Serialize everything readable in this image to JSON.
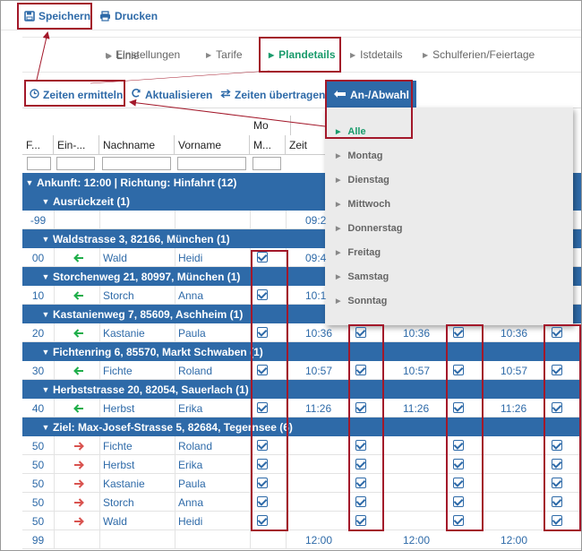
{
  "toolbar": {
    "save": "Speichern",
    "print": "Drucken"
  },
  "tabs": [
    {
      "label": "Linie",
      "active": false
    },
    {
      "label": "Einstellungen",
      "active": false
    },
    {
      "label": "Tarife",
      "active": false
    },
    {
      "label": "Plandetails",
      "active": true
    },
    {
      "label": "Istdetails",
      "active": false
    },
    {
      "label": "Schulferien/Feiertage",
      "active": false
    }
  ],
  "actions": {
    "calc_times": "Zeiten ermitteln",
    "refresh": "Aktualisieren",
    "transfer": "Zeiten übertragen",
    "pickup": "An-/Abwahl"
  },
  "grid": {
    "day_group": "Mo",
    "columns": [
      "F...",
      "Ein-...",
      "Nachname",
      "Vorname",
      "M...",
      "Zeit"
    ]
  },
  "dropdown": {
    "items": [
      {
        "label": "Alle",
        "selected": true
      },
      {
        "label": "Montag",
        "selected": false
      },
      {
        "label": "Dienstag",
        "selected": false
      },
      {
        "label": "Mittwoch",
        "selected": false
      },
      {
        "label": "Donnerstag",
        "selected": false
      },
      {
        "label": "Freitag",
        "selected": false
      },
      {
        "label": "Samstag",
        "selected": false
      },
      {
        "label": "Sonntag",
        "selected": false
      }
    ]
  },
  "rows": [
    {
      "kind": "group",
      "level": 0,
      "label": "Ankunft: 12:00 | Richtung: Hinfahrt (12)"
    },
    {
      "kind": "group",
      "level": 1,
      "label": "Ausrückzeit (1)"
    },
    {
      "kind": "data",
      "f": "-99",
      "arrow": "",
      "last": "",
      "first": "",
      "checks": false,
      "times": [
        "09:2",
        "",
        "",
        ""
      ]
    },
    {
      "kind": "group",
      "level": 1,
      "label": "Waldstrasse 3, 82166, München (1)"
    },
    {
      "kind": "data",
      "f": "00",
      "arrow": "left",
      "last": "Wald",
      "first": "Heidi",
      "checks": [
        true,
        false,
        false,
        false
      ],
      "times": [
        "09:4",
        "",
        "",
        ""
      ]
    },
    {
      "kind": "group",
      "level": 1,
      "label": "Storchenweg 21, 80997, München (1)"
    },
    {
      "kind": "data",
      "f": "10",
      "arrow": "left",
      "last": "Storch",
      "first": "Anna",
      "checks": [
        true,
        false,
        false,
        false
      ],
      "times": [
        "10:1",
        "",
        "",
        ""
      ]
    },
    {
      "kind": "group",
      "level": 1,
      "label": "Kastanienweg 7, 85609, Aschheim (1)"
    },
    {
      "kind": "data",
      "f": "20",
      "arrow": "left",
      "last": "Kastanie",
      "first": "Paula",
      "checks": [
        true,
        true,
        true,
        true
      ],
      "times": [
        "10:36",
        "10:36",
        "10:36",
        "10:36"
      ]
    },
    {
      "kind": "group",
      "level": 1,
      "label": "Fichtenring 6, 85570, Markt Schwaben (1)"
    },
    {
      "kind": "data",
      "f": "30",
      "arrow": "left",
      "last": "Fichte",
      "first": "Roland",
      "checks": [
        true,
        true,
        true,
        true
      ],
      "times": [
        "10:57",
        "10:57",
        "10:57",
        "10:57"
      ]
    },
    {
      "kind": "group",
      "level": 1,
      "label": "Herbststrasse 20, 82054, Sauerlach (1)"
    },
    {
      "kind": "data",
      "f": "40",
      "arrow": "left",
      "last": "Herbst",
      "first": "Erika",
      "checks": [
        true,
        true,
        true,
        true
      ],
      "times": [
        "11:26",
        "11:26",
        "11:26",
        "11:26"
      ]
    },
    {
      "kind": "group",
      "level": 1,
      "label": "Ziel: Max-Josef-Strasse 5, 82684, Tegernsee (6)"
    },
    {
      "kind": "data",
      "f": "50",
      "arrow": "right",
      "last": "Fichte",
      "first": "Roland",
      "checks": [
        true,
        true,
        true,
        true
      ],
      "times": [
        "",
        "",
        "",
        ""
      ]
    },
    {
      "kind": "data",
      "f": "50",
      "arrow": "right",
      "last": "Herbst",
      "first": "Erika",
      "checks": [
        true,
        true,
        true,
        true
      ],
      "times": [
        "",
        "",
        "",
        ""
      ]
    },
    {
      "kind": "data",
      "f": "50",
      "arrow": "right",
      "last": "Kastanie",
      "first": "Paula",
      "checks": [
        true,
        true,
        true,
        true
      ],
      "times": [
        "",
        "",
        "",
        ""
      ]
    },
    {
      "kind": "data",
      "f": "50",
      "arrow": "right",
      "last": "Storch",
      "first": "Anna",
      "checks": [
        true,
        true,
        true,
        true
      ],
      "times": [
        "",
        "",
        "",
        ""
      ]
    },
    {
      "kind": "data",
      "f": "50",
      "arrow": "right",
      "last": "Wald",
      "first": "Heidi",
      "checks": [
        true,
        true,
        true,
        true
      ],
      "times": [
        "",
        "",
        "",
        ""
      ]
    },
    {
      "kind": "data",
      "f": "99",
      "arrow": "",
      "last": "",
      "first": "",
      "checks": false,
      "times": [
        "12:00",
        "12:00",
        "12:00",
        ""
      ]
    }
  ],
  "colors": {
    "accent": "#2e6aa8",
    "active_tab": "#1a9b6c",
    "annotation": "#a3182a",
    "arrow_left": "#1fae4a",
    "arrow_right": "#d9534f"
  }
}
